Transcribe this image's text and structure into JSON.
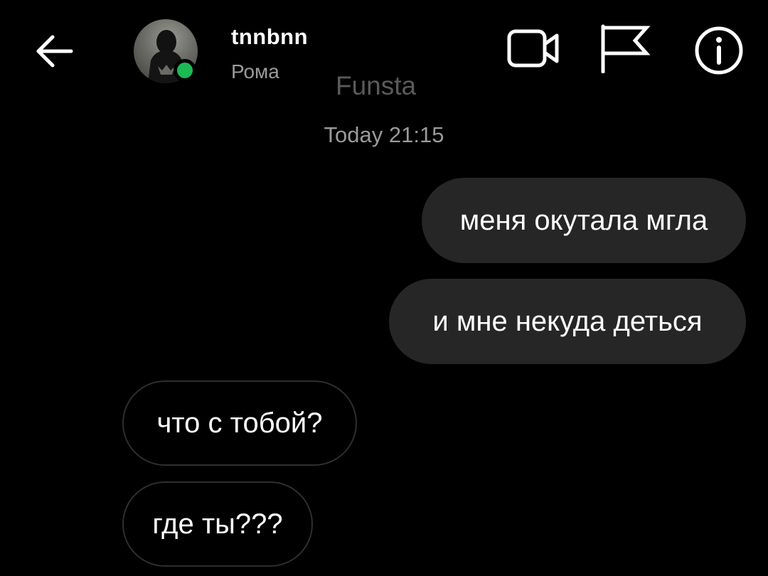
{
  "header": {
    "back_icon": "arrow-left-icon",
    "username": "tnnbnn",
    "subname": "Рома",
    "online_color": "#1db954",
    "video_icon": "video-camera-icon",
    "flag_icon": "flag-icon",
    "info_icon": "info-icon"
  },
  "overlay_label": "Funsta",
  "thread": {
    "timestamp": "Today 21:15",
    "messages": [
      {
        "direction": "outgoing",
        "text": "меня окутала мгла"
      },
      {
        "direction": "outgoing",
        "text": "и мне некуда деться"
      },
      {
        "direction": "incoming",
        "text": "что с тобой?"
      },
      {
        "direction": "incoming",
        "text": "где ты???"
      }
    ]
  },
  "colors": {
    "background": "#000000",
    "outgoing_bubble": "#262626",
    "incoming_border": "#2e2e2e",
    "muted_text": "#9a9a9a"
  }
}
